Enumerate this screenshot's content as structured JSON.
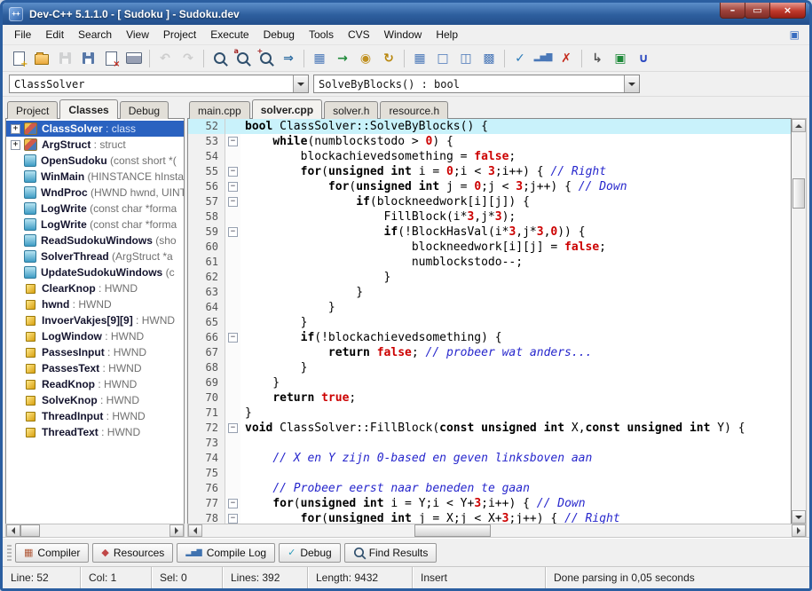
{
  "window": {
    "title": "Dev-C++ 5.1.1.0 - [ Sudoku ] - Sudoku.dev",
    "app_icon": "dev-cpp-logo",
    "controls": [
      {
        "name": "minimize-button",
        "glyph": "–"
      },
      {
        "name": "maximize-button",
        "glyph": "▭"
      },
      {
        "name": "close-button",
        "glyph": "×"
      }
    ]
  },
  "menu": {
    "items": [
      "File",
      "Edit",
      "Search",
      "View",
      "Project",
      "Execute",
      "Debug",
      "Tools",
      "CVS",
      "Window",
      "Help"
    ],
    "child_icon": {
      "name": "mdi-child-icon",
      "glyph": "▣",
      "color": "#3a6ec0"
    }
  },
  "toolbar": {
    "icons": [
      {
        "name": "new-source-icon",
        "type": "page",
        "deco": "+",
        "deco_color": "#d29a00"
      },
      {
        "name": "open-icon",
        "type": "folder"
      },
      {
        "name": "save-icon",
        "type": "floppy",
        "color": "#9aa4b4",
        "disabled": true
      },
      {
        "name": "save-all-icon",
        "type": "floppy",
        "color": "#5878a8"
      },
      {
        "name": "close-file-icon",
        "type": "page",
        "deco": "×",
        "deco_color": "#c42b1c"
      },
      {
        "name": "print-icon",
        "type": "print"
      },
      {
        "sep": true
      },
      {
        "name": "undo-icon",
        "type": "glyph",
        "glyph": "↶",
        "color": "#9a9a9a",
        "disabled": true
      },
      {
        "name": "redo-icon",
        "type": "glyph",
        "glyph": "↷",
        "color": "#9a9a9a",
        "disabled": true
      },
      {
        "sep": true
      },
      {
        "name": "find-icon",
        "type": "mag"
      },
      {
        "name": "replace-icon",
        "type": "mag",
        "deco": "a"
      },
      {
        "name": "find-in-files-icon",
        "type": "mag",
        "deco": "+"
      },
      {
        "name": "goto-line-icon",
        "type": "glyph",
        "glyph": "⇒",
        "color": "#2a6aa0"
      },
      {
        "sep": true
      },
      {
        "name": "compile-icon",
        "type": "glyph",
        "glyph": "▦",
        "color": "#4a78b8"
      },
      {
        "name": "run-icon",
        "type": "glyph",
        "glyph": "→",
        "color": "#1f8a3a"
      },
      {
        "name": "compile-run-icon",
        "type": "glyph",
        "glyph": "◉",
        "color": "#c09020"
      },
      {
        "name": "rebuild-icon",
        "type": "glyph",
        "glyph": "↻",
        "color": "#b8860b"
      },
      {
        "sep": true
      },
      {
        "name": "add-to-project-icon",
        "type": "glyph",
        "glyph": "▦",
        "color": "#4a78b8"
      },
      {
        "name": "remove-from-project-icon",
        "type": "glyph",
        "glyph": "□",
        "color": "#4a78b8"
      },
      {
        "name": "project-options-icon",
        "type": "glyph",
        "glyph": "◫",
        "color": "#4a78b8"
      },
      {
        "name": "project-manager-icon",
        "type": "glyph",
        "glyph": "▩",
        "color": "#4a78b8"
      },
      {
        "sep": true
      },
      {
        "name": "syntax-check-icon",
        "type": "glyph",
        "glyph": "✓",
        "color": "#2b7bb9"
      },
      {
        "name": "profile-icon",
        "type": "glyph",
        "glyph": "▂▅▇",
        "color": "#4a78b8",
        "size": 9
      },
      {
        "name": "abort-icon",
        "type": "glyph",
        "glyph": "✗",
        "color": "#c42b1c"
      },
      {
        "sep": true
      },
      {
        "name": "insert-icon",
        "type": "glyph",
        "glyph": "↳",
        "color": "#555555"
      },
      {
        "name": "toggle-bookmark-icon",
        "type": "glyph",
        "glyph": "▣",
        "color": "#1f8a3a"
      },
      {
        "name": "goto-bookmark-icon",
        "type": "glyph",
        "glyph": "∪",
        "color": "#2a48c0"
      }
    ]
  },
  "navigator": {
    "class_combo": "ClassSolver",
    "member_combo": "SolveByBlocks() : bool"
  },
  "left_panel": {
    "expand_glyph": "+",
    "tabs": [
      {
        "label": "Project"
      },
      {
        "label": "Classes",
        "active": true
      },
      {
        "label": "Debug"
      }
    ],
    "tree": [
      {
        "name": "ClassSolver",
        "suffix": " : class",
        "kind": "class",
        "expandable": true,
        "selected": true
      },
      {
        "name": "ArgStruct",
        "suffix": " : struct",
        "kind": "class",
        "expandable": true
      },
      {
        "name": "OpenSudoku",
        "suffix": " (const short *(",
        "kind": "method"
      },
      {
        "name": "WinMain",
        "suffix": " (HINSTANCE hInsta",
        "kind": "method"
      },
      {
        "name": "WndProc",
        "suffix": " (HWND hwnd, UINT",
        "kind": "method"
      },
      {
        "name": "LogWrite",
        "suffix": " (const char *forma",
        "kind": "method"
      },
      {
        "name": "LogWrite",
        "suffix": " (const char *forma",
        "kind": "method"
      },
      {
        "name": "ReadSudokuWindows",
        "suffix": " (sho",
        "kind": "method"
      },
      {
        "name": "SolverThread",
        "suffix": " (ArgStruct *a",
        "kind": "method"
      },
      {
        "name": "UpdateSudokuWindows",
        "suffix": " (c",
        "kind": "method"
      },
      {
        "name": "ClearKnop",
        "suffix": " : HWND",
        "kind": "field"
      },
      {
        "name": "hwnd",
        "suffix": " : HWND",
        "kind": "field"
      },
      {
        "name": "InvoerVakjes[9][9]",
        "suffix": " : HWND",
        "kind": "field"
      },
      {
        "name": "LogWindow",
        "suffix": " : HWND",
        "kind": "field"
      },
      {
        "name": "PassesInput",
        "suffix": " : HWND",
        "kind": "field"
      },
      {
        "name": "PassesText",
        "suffix": " : HWND",
        "kind": "field"
      },
      {
        "name": "ReadKnop",
        "suffix": " : HWND",
        "kind": "field"
      },
      {
        "name": "SolveKnop",
        "suffix": " : HWND",
        "kind": "field"
      },
      {
        "name": "ThreadInput",
        "suffix": " : HWND",
        "kind": "field"
      },
      {
        "name": "ThreadText",
        "suffix": " : HWND",
        "kind": "field"
      }
    ]
  },
  "editor": {
    "fold_glyph": "−",
    "tabs": [
      {
        "label": "main.cpp"
      },
      {
        "label": "solver.cpp",
        "active": true
      },
      {
        "label": "solver.h"
      },
      {
        "label": "resource.h"
      }
    ],
    "lines": [
      {
        "n": 52,
        "cur": true,
        "t": [
          [
            "k",
            "bool"
          ],
          [
            "p",
            " ClassSolver::SolveByBlocks() {"
          ]
        ]
      },
      {
        "n": 53,
        "fold": true,
        "t": [
          [
            "p",
            "    "
          ],
          [
            "k",
            "while"
          ],
          [
            "p",
            "(numblockstodo > "
          ],
          [
            "n",
            "0"
          ],
          [
            "p",
            ") {"
          ]
        ]
      },
      {
        "n": 54,
        "t": [
          [
            "p",
            "        blockachievedsomething = "
          ],
          [
            "b",
            "false"
          ],
          [
            "p",
            ";"
          ]
        ]
      },
      {
        "n": 55,
        "fold": true,
        "t": [
          [
            "p",
            "        "
          ],
          [
            "k",
            "for"
          ],
          [
            "p",
            "("
          ],
          [
            "k",
            "unsigned"
          ],
          [
            "p",
            " "
          ],
          [
            "k",
            "int"
          ],
          [
            "p",
            " i = "
          ],
          [
            "n",
            "0"
          ],
          [
            "p",
            ";i < "
          ],
          [
            "n",
            "3"
          ],
          [
            "p",
            ";i++) { "
          ],
          [
            "c",
            "// Right"
          ]
        ]
      },
      {
        "n": 56,
        "fold": true,
        "t": [
          [
            "p",
            "            "
          ],
          [
            "k",
            "for"
          ],
          [
            "p",
            "("
          ],
          [
            "k",
            "unsigned"
          ],
          [
            "p",
            " "
          ],
          [
            "k",
            "int"
          ],
          [
            "p",
            " j = "
          ],
          [
            "n",
            "0"
          ],
          [
            "p",
            ";j < "
          ],
          [
            "n",
            "3"
          ],
          [
            "p",
            ";j++) { "
          ],
          [
            "c",
            "// Down"
          ]
        ]
      },
      {
        "n": 57,
        "fold": true,
        "t": [
          [
            "p",
            "                "
          ],
          [
            "k",
            "if"
          ],
          [
            "p",
            "(blockneedwork[i][j]) {"
          ]
        ]
      },
      {
        "n": 58,
        "t": [
          [
            "p",
            "                    FillBlock(i*"
          ],
          [
            "n",
            "3"
          ],
          [
            "p",
            ",j*"
          ],
          [
            "n",
            "3"
          ],
          [
            "p",
            ");"
          ]
        ]
      },
      {
        "n": 59,
        "fold": true,
        "t": [
          [
            "p",
            "                    "
          ],
          [
            "k",
            "if"
          ],
          [
            "p",
            "(!BlockHasVal(i*"
          ],
          [
            "n",
            "3"
          ],
          [
            "p",
            ",j*"
          ],
          [
            "n",
            "3"
          ],
          [
            "p",
            ","
          ],
          [
            "n",
            "0"
          ],
          [
            "p",
            ")) {"
          ]
        ]
      },
      {
        "n": 60,
        "t": [
          [
            "p",
            "                        blockneedwork[i][j] = "
          ],
          [
            "b",
            "false"
          ],
          [
            "p",
            ";"
          ]
        ]
      },
      {
        "n": 61,
        "t": [
          [
            "p",
            "                        numblockstodo--;"
          ]
        ]
      },
      {
        "n": 62,
        "t": [
          [
            "p",
            "                    }"
          ]
        ]
      },
      {
        "n": 63,
        "t": [
          [
            "p",
            "                }"
          ]
        ]
      },
      {
        "n": 64,
        "t": [
          [
            "p",
            "            }"
          ]
        ]
      },
      {
        "n": 65,
        "t": [
          [
            "p",
            "        }"
          ]
        ]
      },
      {
        "n": 66,
        "fold": true,
        "t": [
          [
            "p",
            "        "
          ],
          [
            "k",
            "if"
          ],
          [
            "p",
            "(!blockachievedsomething) {"
          ]
        ]
      },
      {
        "n": 67,
        "t": [
          [
            "p",
            "            "
          ],
          [
            "k",
            "return"
          ],
          [
            "p",
            " "
          ],
          [
            "b",
            "false"
          ],
          [
            "p",
            "; "
          ],
          [
            "c",
            "// probeer wat anders..."
          ]
        ]
      },
      {
        "n": 68,
        "t": [
          [
            "p",
            "        }"
          ]
        ]
      },
      {
        "n": 69,
        "t": [
          [
            "p",
            "    }"
          ]
        ]
      },
      {
        "n": 70,
        "t": [
          [
            "p",
            "    "
          ],
          [
            "k",
            "return"
          ],
          [
            "p",
            " "
          ],
          [
            "b",
            "true"
          ],
          [
            "p",
            ";"
          ]
        ]
      },
      {
        "n": 71,
        "t": [
          [
            "p",
            "}"
          ]
        ]
      },
      {
        "n": 72,
        "fold": true,
        "t": [
          [
            "k",
            "void"
          ],
          [
            "p",
            " ClassSolver::FillBlock("
          ],
          [
            "k",
            "const"
          ],
          [
            "p",
            " "
          ],
          [
            "k",
            "unsigned"
          ],
          [
            "p",
            " "
          ],
          [
            "k",
            "int"
          ],
          [
            "p",
            " X,"
          ],
          [
            "k",
            "const"
          ],
          [
            "p",
            " "
          ],
          [
            "k",
            "unsigned"
          ],
          [
            "p",
            " "
          ],
          [
            "k",
            "int"
          ],
          [
            "p",
            " Y) {"
          ]
        ]
      },
      {
        "n": 73,
        "t": []
      },
      {
        "n": 74,
        "t": [
          [
            "p",
            "    "
          ],
          [
            "c",
            "// X en Y zijn 0-based en geven linksboven aan"
          ]
        ]
      },
      {
        "n": 75,
        "t": []
      },
      {
        "n": 76,
        "t": [
          [
            "p",
            "    "
          ],
          [
            "c",
            "// Probeer eerst naar beneden te gaan"
          ]
        ]
      },
      {
        "n": 77,
        "fold": true,
        "t": [
          [
            "p",
            "    "
          ],
          [
            "k",
            "for"
          ],
          [
            "p",
            "("
          ],
          [
            "k",
            "unsigned"
          ],
          [
            "p",
            " "
          ],
          [
            "k",
            "int"
          ],
          [
            "p",
            " i = Y;i < Y+"
          ],
          [
            "n",
            "3"
          ],
          [
            "p",
            ";i++) { "
          ],
          [
            "c",
            "// Down"
          ]
        ]
      },
      {
        "n": 78,
        "fold": true,
        "t": [
          [
            "p",
            "        "
          ],
          [
            "k",
            "for"
          ],
          [
            "p",
            "("
          ],
          [
            "k",
            "unsigned"
          ],
          [
            "p",
            " "
          ],
          [
            "k",
            "int"
          ],
          [
            "p",
            " j = X;j < X+"
          ],
          [
            "n",
            "3"
          ],
          [
            "p",
            ";j++) { "
          ],
          [
            "c",
            "// Right"
          ]
        ]
      }
    ]
  },
  "bottom_tabs": [
    {
      "label": "Compiler",
      "icon": {
        "name": "compiler-icon",
        "type": "glyph",
        "glyph": "▦",
        "color": "#b05838"
      }
    },
    {
      "label": "Resources",
      "icon": {
        "name": "resources-icon",
        "type": "glyph",
        "glyph": "◆",
        "color": "#c04848"
      }
    },
    {
      "label": "Compile Log",
      "icon": {
        "name": "compile-log-icon",
        "type": "glyph",
        "glyph": "▂▅▇",
        "color": "#3f72af",
        "size": 8
      }
    },
    {
      "label": "Debug",
      "icon": {
        "name": "debug-tab-icon",
        "type": "glyph",
        "glyph": "✓",
        "color": "#2b9bb9"
      }
    },
    {
      "label": "Find Results",
      "icon": {
        "name": "find-results-icon",
        "type": "mag"
      }
    }
  ],
  "status_bar": {
    "line": "Line: 52",
    "col": "Col: 1",
    "sel": "Sel: 0",
    "lines": "Lines: 392",
    "length": "Length: 9432",
    "mode": "Insert",
    "message": "Done parsing in 0,05 seconds"
  }
}
